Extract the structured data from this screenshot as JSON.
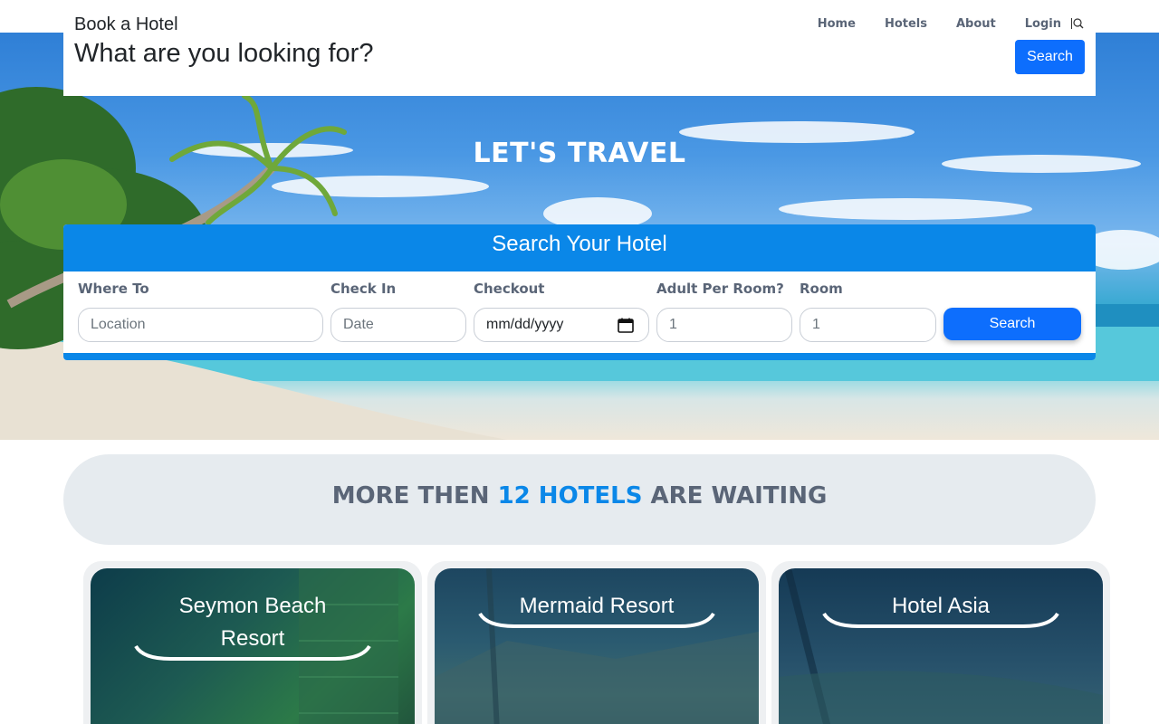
{
  "header": {
    "brand": "Book a Hotel",
    "headline": "What are you looking for?",
    "nav": [
      "Home",
      "Hotels",
      "About",
      "Login"
    ],
    "search_button": "Search"
  },
  "hero": {
    "title": "LET'S TRAVEL"
  },
  "search_form": {
    "heading": "Search Your Hotel",
    "fields": [
      {
        "label": "Where To",
        "placeholder": "Location",
        "value": ""
      },
      {
        "label": "Check In",
        "placeholder": "Date",
        "value": ""
      },
      {
        "label": "Checkout",
        "placeholder": "",
        "value": "mm/dd/yyyy"
      },
      {
        "label": "Adult Per Room?",
        "placeholder": "",
        "value": "1"
      },
      {
        "label": "Room",
        "placeholder": "",
        "value": "1"
      }
    ],
    "submit_label": "Search"
  },
  "banner": {
    "prefix": "MORE THEN ",
    "highlight": "12 HOTELS",
    "suffix": " ARE WAITING"
  },
  "hotels": [
    {
      "name": "Seymon Beach Resort"
    },
    {
      "name": "Mermaid Resort"
    },
    {
      "name": "Hotel Asia"
    }
  ],
  "colors": {
    "primary": "#0d6efd",
    "accent_blue": "#0a87e8",
    "label_gray": "#5a6577",
    "banner_bg": "#e6ebef"
  }
}
